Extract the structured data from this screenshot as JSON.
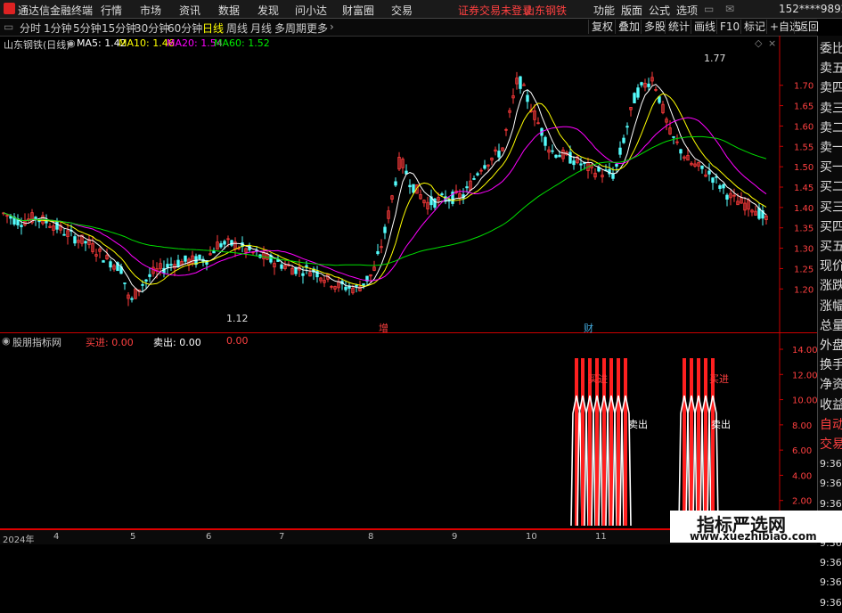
{
  "menubar": {
    "app_name": "通达信金融终端",
    "items": [
      "行情",
      "市场",
      "资讯",
      "数据",
      "发现",
      "问小达",
      "财富圈",
      "交易"
    ],
    "notice": "证券交易未登录",
    "stock": "山东钢铁",
    "right_items": [
      "功能",
      "版面",
      "公式",
      "选项"
    ],
    "account": "152****9892"
  },
  "periodbar": {
    "periods": [
      "分时",
      "1分钟",
      "5分钟",
      "15分钟",
      "30分钟",
      "60分钟",
      "日线",
      "周线",
      "月线",
      "多周期",
      "更多"
    ],
    "selected": "日线",
    "right_buttons": [
      "复权",
      "叠加",
      "多股",
      "统计",
      "画线",
      "F10",
      "标记",
      "+自选",
      "返回"
    ]
  },
  "main_chart": {
    "title": "山东钢铁(日线)",
    "ma": [
      {
        "label": "MA5: 1.42",
        "color": "#ffffff"
      },
      {
        "label": "MA10: 1.46",
        "color": "#ffff00"
      },
      {
        "label": "MA20: 1.54",
        "color": "#ff00ff"
      },
      {
        "label": "MA60: 1.52",
        "color": "#00e000"
      }
    ],
    "high_label": "1.77",
    "low_label": "1.12",
    "markers": [
      "增",
      "财"
    ]
  },
  "chart_data": {
    "type": "candlestick",
    "title": "山东钢铁(日线)",
    "yticks": [
      1.2,
      1.25,
      1.3,
      1.35,
      1.4,
      1.45,
      1.5,
      1.55,
      1.6,
      1.65,
      1.7
    ],
    "ylim": [
      1.1,
      1.8
    ],
    "x_labels": [
      "2024年",
      "4",
      "5",
      "6",
      "7",
      "8",
      "9",
      "10",
      "11"
    ],
    "ma5_last": 1.42,
    "ma10_last": 1.46,
    "ma20_last": 1.54,
    "ma60_last": 1.52,
    "period_high": 1.77,
    "period_low": 1.12,
    "indicator": {
      "name": "股朋指标网",
      "buy": "0.00",
      "sell": "0.00",
      "extra": "0.00",
      "yticks": [
        0.0,
        2.0,
        4.0,
        6.0,
        8.0,
        10.0,
        12.0,
        14.0
      ],
      "signal_texts": [
        "买进",
        "卖出",
        "买进",
        "卖出"
      ]
    }
  },
  "sidebar": {
    "items": [
      "委比",
      "卖五",
      "卖四",
      "卖三",
      "卖二",
      "卖一",
      "买一",
      "买二",
      "买三",
      "买四",
      "买五",
      "现价",
      "涨跌",
      "涨幅",
      "总量",
      "外盘",
      "换手",
      "净资",
      "收益",
      "自动",
      "交易",
      "9:36",
      "9:36",
      "9:36",
      "9:36",
      "9:36",
      "9:36",
      "9:36",
      "9:36"
    ]
  },
  "sub_chart": {
    "buy_label": "买进: 0.00",
    "sell_label": "卖出: 0.00",
    "extra_label": "0.00",
    "title": "股朋指标网"
  },
  "time_axis": [
    "2024年",
    "4",
    "5",
    "6",
    "7",
    "8",
    "9",
    "10",
    "11"
  ],
  "watermark": {
    "title": "指标严选网",
    "url": "www.xuezhibiao.com"
  }
}
